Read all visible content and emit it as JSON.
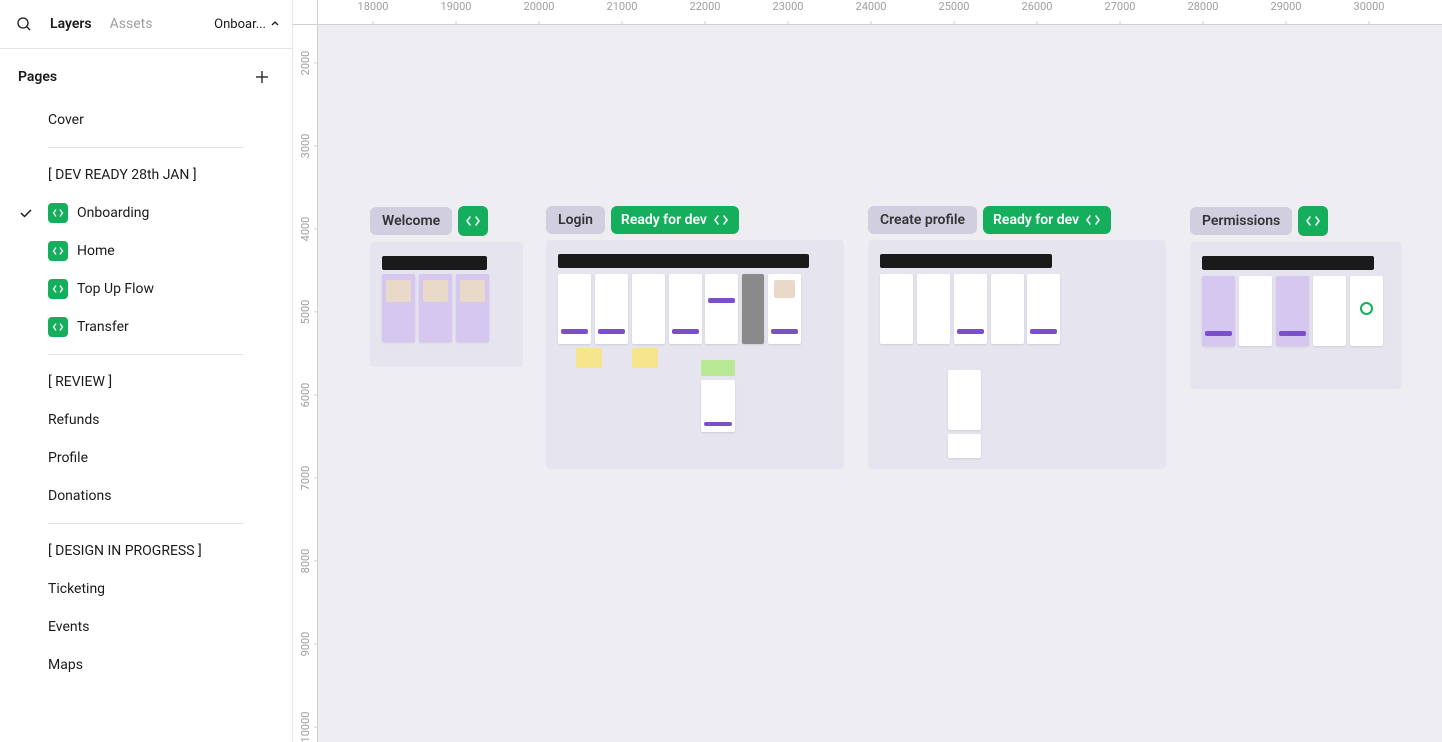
{
  "tabs": {
    "layers": "Layers",
    "assets": "Assets",
    "current_page": "Onboar..."
  },
  "pages": {
    "header": "Pages",
    "items": [
      {
        "label": "Cover",
        "divider_after": true
      },
      {
        "label": "[ DEV READY 28th JAN ]"
      },
      {
        "label": "Onboarding",
        "active": true,
        "badge": true
      },
      {
        "label": "Home",
        "badge": true
      },
      {
        "label": "Top Up Flow",
        "badge": true
      },
      {
        "label": "Transfer",
        "badge": true,
        "divider_after": true
      },
      {
        "label": "[ REVIEW ]"
      },
      {
        "label": "Refunds"
      },
      {
        "label": "Profile"
      },
      {
        "label": "Donations",
        "divider_after": true
      },
      {
        "label": "[ DESIGN IN PROGRESS ]"
      },
      {
        "label": "Ticketing"
      },
      {
        "label": "Events"
      },
      {
        "label": "Maps"
      }
    ]
  },
  "ruler": {
    "horizontal": [
      18000,
      19000,
      20000,
      21000,
      22000,
      23000,
      24000,
      25000,
      26000,
      27000,
      28000,
      29000,
      30000
    ],
    "vertical": [
      2000,
      3000,
      4000,
      5000,
      6000,
      7000,
      8000,
      9000,
      10000
    ]
  },
  "sections": {
    "welcome": {
      "title": "Welcome"
    },
    "login": {
      "title": "Login",
      "status": "Ready for dev"
    },
    "create_profile": {
      "title": "Create profile",
      "status": "Ready for dev"
    },
    "permissions": {
      "title": "Permissions"
    }
  },
  "colors": {
    "dev_green": "#14ae5c",
    "section_bg": "#e6e4ee",
    "label_bg": "#d1cee0"
  }
}
